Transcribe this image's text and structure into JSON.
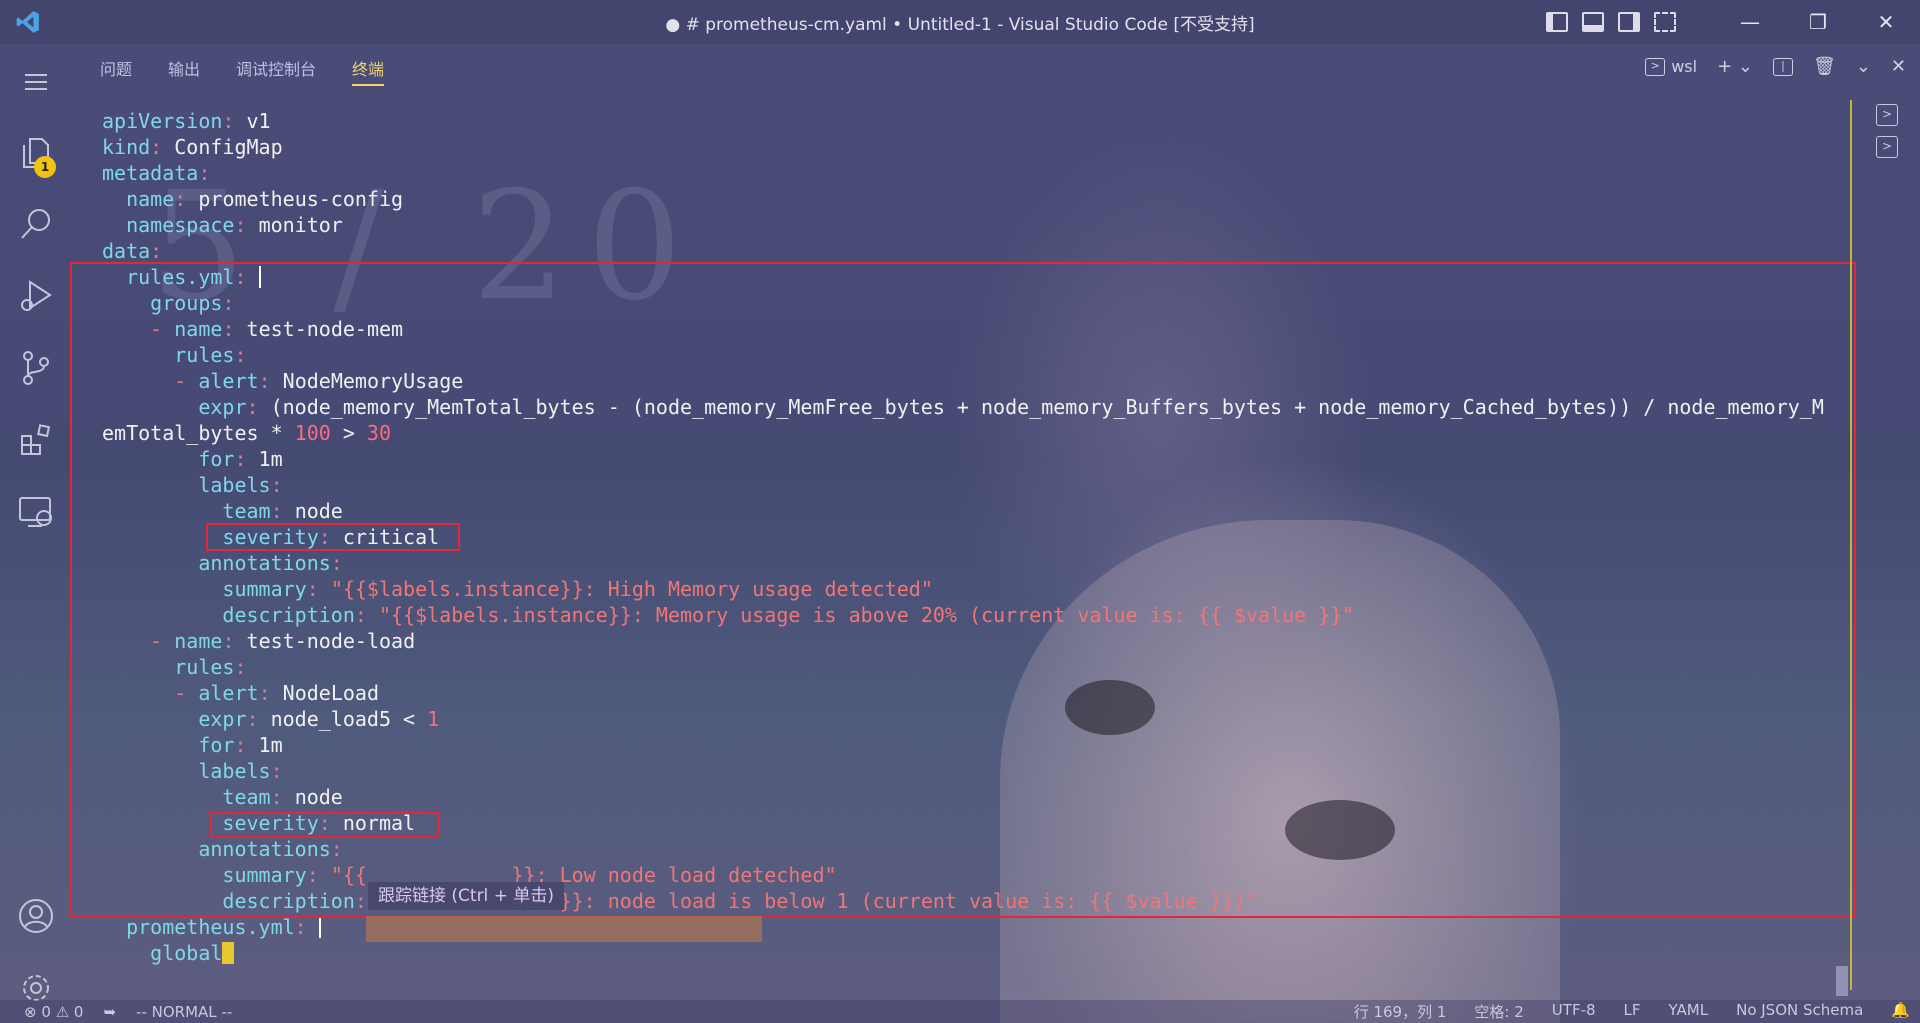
{
  "window": {
    "title": "● # prometheus-cm.yaml • Untitled-1 - Visual Studio Code [不受支持]"
  },
  "activity": {
    "explorer_badge": "1"
  },
  "panel": {
    "tabs": [
      "问题",
      "输出",
      "调试控制台",
      "终端"
    ],
    "active_tab": "终端",
    "terminal_name": "wsl"
  },
  "editor": {
    "lines": [
      [
        [
          "k",
          "apiVersion"
        ],
        [
          "p",
          ": "
        ],
        [
          "v",
          "v1"
        ]
      ],
      [
        [
          "k",
          "kind"
        ],
        [
          "p",
          ": "
        ],
        [
          "v",
          "ConfigMap"
        ]
      ],
      [
        [
          "k",
          "metadata"
        ],
        [
          "p",
          ":"
        ]
      ],
      [
        [
          "v",
          "  "
        ],
        [
          "k",
          "name"
        ],
        [
          "p",
          ": "
        ],
        [
          "v",
          "prometheus-config"
        ]
      ],
      [
        [
          "v",
          "  "
        ],
        [
          "k",
          "namespace"
        ],
        [
          "p",
          ": "
        ],
        [
          "v",
          "monitor"
        ]
      ],
      [
        [
          "k",
          "data"
        ],
        [
          "p",
          ":"
        ]
      ],
      [
        [
          "v",
          "  "
        ],
        [
          "k",
          "rules.yml"
        ],
        [
          "p",
          ": "
        ],
        [
          "cursor",
          ""
        ]
      ],
      [
        [
          "v",
          "    "
        ],
        [
          "k",
          "groups"
        ],
        [
          "p",
          ":"
        ]
      ],
      [
        [
          "v",
          "    "
        ],
        [
          "p",
          "- "
        ],
        [
          "k",
          "name"
        ],
        [
          "p",
          ": "
        ],
        [
          "v",
          "test-node-mem"
        ]
      ],
      [
        [
          "v",
          "      "
        ],
        [
          "k",
          "rules"
        ],
        [
          "p",
          ":"
        ]
      ],
      [
        [
          "v",
          "      "
        ],
        [
          "p",
          "- "
        ],
        [
          "k",
          "alert"
        ],
        [
          "p",
          ": "
        ],
        [
          "v",
          "NodeMemoryUsage"
        ]
      ],
      [
        [
          "v",
          "        "
        ],
        [
          "k",
          "expr"
        ],
        [
          "p",
          ": "
        ],
        [
          "v",
          "(node_memory_MemTotal_bytes - (node_memory_MemFree_bytes + node_memory_Buffers_bytes + node_memory_Cached_bytes)) / node_memory_M"
        ]
      ],
      [
        [
          "v",
          "emTotal_bytes * "
        ],
        [
          "n",
          "100"
        ],
        [
          "v",
          " > "
        ],
        [
          "n",
          "30"
        ]
      ],
      [
        [
          "v",
          "        "
        ],
        [
          "k",
          "for"
        ],
        [
          "p",
          ": "
        ],
        [
          "v",
          "1m"
        ]
      ],
      [
        [
          "v",
          "        "
        ],
        [
          "k",
          "labels"
        ],
        [
          "p",
          ":"
        ]
      ],
      [
        [
          "v",
          "          "
        ],
        [
          "k",
          "team"
        ],
        [
          "p",
          ": "
        ],
        [
          "v",
          "node"
        ]
      ],
      [
        [
          "v",
          "          "
        ],
        [
          "k",
          "severity"
        ],
        [
          "p",
          ": "
        ],
        [
          "v",
          "critical"
        ]
      ],
      [
        [
          "v",
          "        "
        ],
        [
          "k",
          "annotations"
        ],
        [
          "p",
          ":"
        ]
      ],
      [
        [
          "v",
          "          "
        ],
        [
          "k",
          "summary"
        ],
        [
          "p",
          ": "
        ],
        [
          "s",
          "\"{{$labels.instance}}: High Memory usage detected\""
        ]
      ],
      [
        [
          "v",
          "          "
        ],
        [
          "k",
          "description"
        ],
        [
          "p",
          ": "
        ],
        [
          "s",
          "\"{{$labels.instance}}: Memory usage is above 20% (current value is: {{ $value }}\""
        ]
      ],
      [
        [
          "v",
          "    "
        ],
        [
          "p",
          "- "
        ],
        [
          "k",
          "name"
        ],
        [
          "p",
          ": "
        ],
        [
          "v",
          "test-node-load"
        ]
      ],
      [
        [
          "v",
          "      "
        ],
        [
          "k",
          "rules"
        ],
        [
          "p",
          ":"
        ]
      ],
      [
        [
          "v",
          "      "
        ],
        [
          "p",
          "- "
        ],
        [
          "k",
          "alert"
        ],
        [
          "p",
          ": "
        ],
        [
          "v",
          "NodeLoad"
        ]
      ],
      [
        [
          "v",
          "        "
        ],
        [
          "k",
          "expr"
        ],
        [
          "p",
          ": "
        ],
        [
          "v",
          "node_load5 < "
        ],
        [
          "n",
          "1"
        ]
      ],
      [
        [
          "v",
          "        "
        ],
        [
          "k",
          "for"
        ],
        [
          "p",
          ": "
        ],
        [
          "v",
          "1m"
        ]
      ],
      [
        [
          "v",
          "        "
        ],
        [
          "k",
          "labels"
        ],
        [
          "p",
          ":"
        ]
      ],
      [
        [
          "v",
          "          "
        ],
        [
          "k",
          "team"
        ],
        [
          "p",
          ": "
        ],
        [
          "v",
          "node"
        ]
      ],
      [
        [
          "v",
          "          "
        ],
        [
          "k",
          "severity"
        ],
        [
          "p",
          ": "
        ],
        [
          "v",
          "normal"
        ]
      ],
      [
        [
          "v",
          "        "
        ],
        [
          "k",
          "annotations"
        ],
        [
          "p",
          ":"
        ]
      ],
      [
        [
          "v",
          "          "
        ],
        [
          "k",
          "summary"
        ],
        [
          "p",
          ": "
        ],
        [
          "s",
          "\"{{            }}: Low node load deteched\""
        ]
      ],
      [
        [
          "v",
          "          "
        ],
        [
          "k",
          "description"
        ],
        [
          "p",
          ": "
        ],
        [
          "s",
          "           nce }}: node load is below 1 (current value is: {{ $value }})\""
        ]
      ],
      [
        [
          "v",
          "  "
        ],
        [
          "k",
          "prometheus.yml"
        ],
        [
          "p",
          ": "
        ],
        [
          "cursor",
          ""
        ]
      ],
      [
        [
          "v",
          "    "
        ],
        [
          "k",
          "global"
        ],
        [
          "block",
          ""
        ]
      ]
    ]
  },
  "tooltip": {
    "text": "跟踪链接 (Ctrl + 单击)"
  },
  "status": {
    "errors": "0",
    "warnings": "0",
    "mode": "-- NORMAL --",
    "position": "行 169，列 1",
    "spaces": "空格: 2",
    "encoding": "UTF-8",
    "eol": "LF",
    "language": "YAML",
    "schema": "No JSON Schema"
  }
}
